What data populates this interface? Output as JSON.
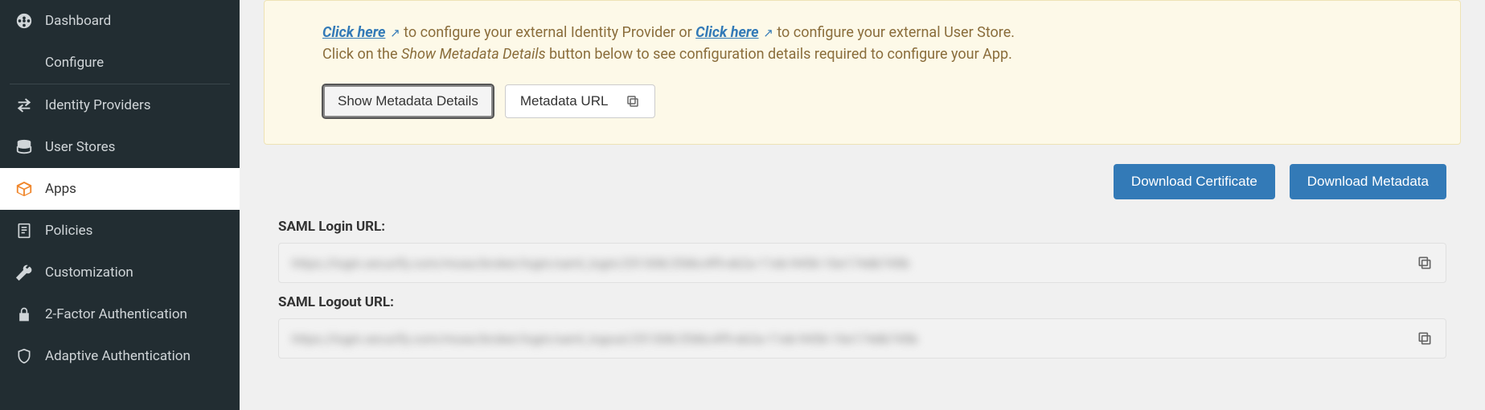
{
  "sidebar": {
    "items": [
      {
        "label": "Dashboard"
      },
      {
        "label": "Configure"
      },
      {
        "label": "Identity Providers"
      },
      {
        "label": "User Stores"
      },
      {
        "label": "Apps"
      },
      {
        "label": "Policies"
      },
      {
        "label": "Customization"
      },
      {
        "label": "2-Factor Authentication"
      },
      {
        "label": "Adaptive Authentication"
      }
    ]
  },
  "info": {
    "link1": "Click here",
    "text1": " to configure your external Identity Provider or ",
    "link2": "Click here",
    "text2": " to configure your external User Store.",
    "line2a": "Click on the ",
    "line2em": "Show Metadata Details",
    "line2b": " button below to see configuration details required to configure your App.",
    "show_metadata_btn": "Show Metadata Details",
    "metadata_url_btn": "Metadata URL"
  },
  "downloads": {
    "cert": "Download Certificate",
    "meta": "Download Metadata"
  },
  "fields": {
    "saml_login_label": "SAML Login URL:",
    "saml_login_value": "https://login.xecurify.com/moas/broker/login/saml_login/251308/2fd6c4f9-eb2a-11eb-9456-16e174db745b",
    "saml_logout_label": "SAML Logout URL:",
    "saml_logout_value": "https://login.xecurify.com/moas/broker/login/saml_logout/251308/2fd6c4f9-eb2a-11eb-9456-16e174db745b"
  }
}
